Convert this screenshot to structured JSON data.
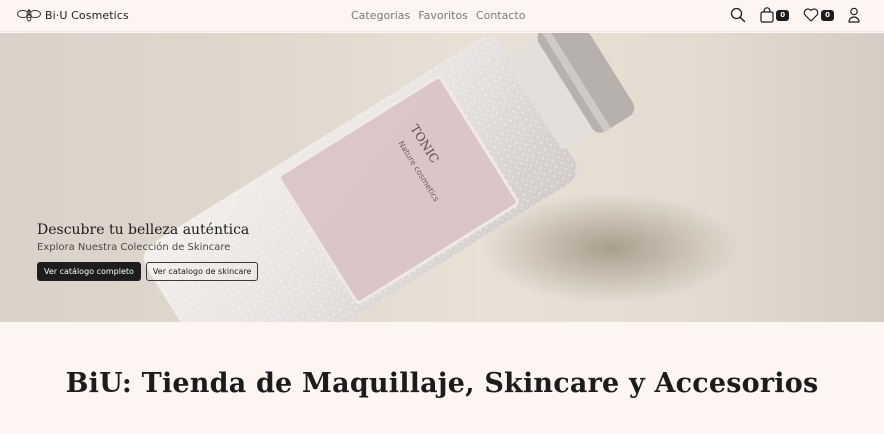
{
  "header": {
    "brand": "Bi·U Cosmetics",
    "nav": [
      "Categorias",
      "Favoritos",
      "Contacto"
    ],
    "cart_count": "0",
    "favorites_count": "0"
  },
  "hero": {
    "title": "Descubre tu belleza auténtica",
    "subtitle": "Explora Nuestra Colección de Skincare",
    "primary_button": "Ver catálogo completo",
    "secondary_button": "Ver catalogo de skincare",
    "bottle_label_title": "TONIC",
    "bottle_label_sub": "Nature cosmetics"
  },
  "main": {
    "title": "BiU: Tienda de Maquillaje, Skincare y Accesorios"
  },
  "colors": {
    "background": "#fdf5f2",
    "primary_button": "#1d1d1f",
    "label_pink": "#d9c3c6"
  }
}
